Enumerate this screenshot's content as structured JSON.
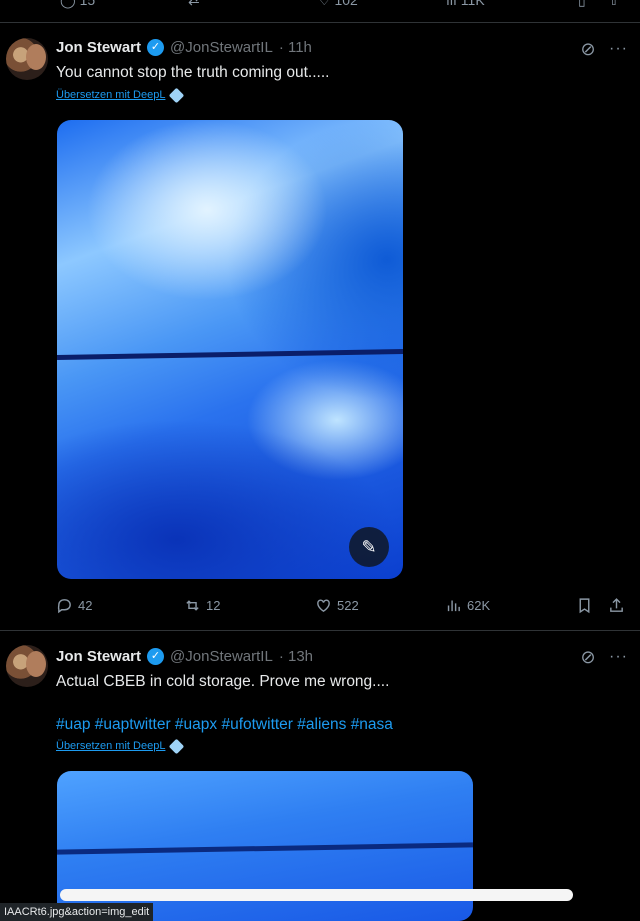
{
  "tweets": [
    {
      "author": "Jon Stewart",
      "handle": "@JonStewartIL",
      "time": "· 11h",
      "text": "You cannot stop the truth coming out.....",
      "translate": "Übersetzen mit DeepL",
      "replies": "42",
      "retweets": "12",
      "likes": "522",
      "views": "62K"
    },
    {
      "author": "Jon Stewart",
      "handle": "@JonStewartIL",
      "time": "· 13h",
      "text": "Actual CBEB in cold storage. Prove me wrong....",
      "hashtags": "#uap #uaptwitter #uapx #ufotwitter #aliens #nasa",
      "translate": "Übersetzen mit DeepL"
    }
  ],
  "top_stats": {
    "replies": "15",
    "views": "11K",
    "likes": "102"
  },
  "status_url": "IAACRt6.jpg&action=img_edit",
  "icons": [
    "reply-icon",
    "retweet-icon",
    "like-icon",
    "views-icon",
    "bookmark-icon",
    "share-icon",
    "grok-icon",
    "more-icon",
    "verified-icon",
    "deepl-icon"
  ]
}
